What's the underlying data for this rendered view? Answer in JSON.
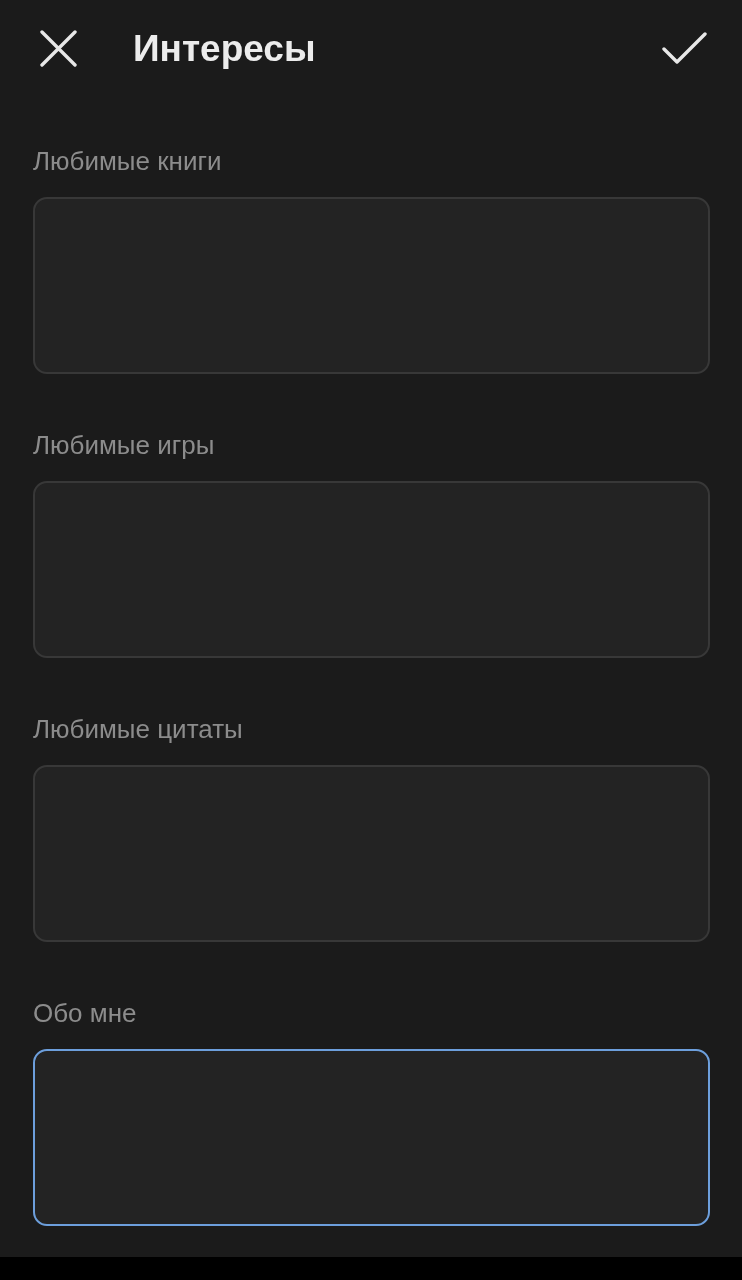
{
  "header": {
    "title": "Интересы"
  },
  "fields": [
    {
      "label": "Любимые книги",
      "focused": false
    },
    {
      "label": "Любимые игры",
      "focused": false
    },
    {
      "label": "Любимые цитаты",
      "focused": false
    },
    {
      "label": "Обо мне",
      "focused": true
    }
  ]
}
